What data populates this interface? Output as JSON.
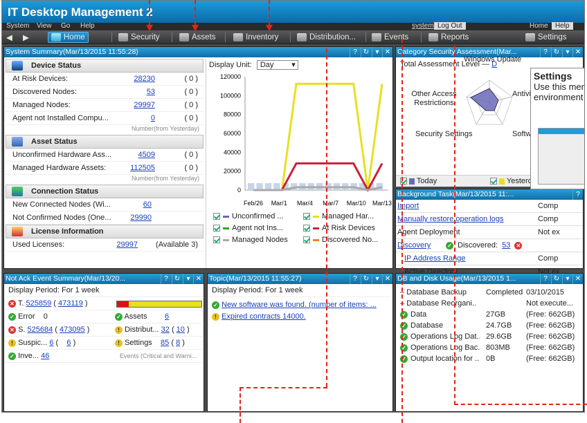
{
  "app": {
    "title": "IT Desktop Management 2"
  },
  "menu": {
    "system": "System",
    "view": "View",
    "go": "Go",
    "help": "Help",
    "user": "system",
    "logout": "Log Out",
    "home": "Home",
    "help_btn": "Help"
  },
  "toolbar": {
    "home": "Home",
    "security": "Security",
    "assets": "Assets",
    "inventory": "Inventory",
    "distribution": "Distribution...",
    "events": "Events",
    "reports": "Reports",
    "settings": "Settings"
  },
  "summary": {
    "title": "System Summary(Mar/13/2015 11:55:28)",
    "device_status": "Device Status",
    "device_rows": [
      {
        "label": "At Risk Devices:",
        "value": "28230",
        "prev": "(    0 )"
      },
      {
        "label": "Discovered Nodes:",
        "value": "53",
        "prev": "(    0 )"
      },
      {
        "label": "Managed Nodes:",
        "value": "29997",
        "prev": "(    0 )"
      },
      {
        "label": "Agent not Installed Compu...",
        "value": "0",
        "prev": "(    0 )"
      }
    ],
    "note": "Number(from Yesterday)",
    "asset_status": "Asset Status",
    "asset_rows": [
      {
        "label": "Unconfirmed Hardware Ass...",
        "value": "4509",
        "prev": "(    0 )"
      },
      {
        "label": "Managed Hardware Assets:",
        "value": "112505",
        "prev": "(    0 )"
      }
    ],
    "connection_status": "Connection Status",
    "conn_rows": [
      {
        "label": "New Connected Nodes (Wi...",
        "value": "60"
      },
      {
        "label": "Not Confirmed Nodes (One...",
        "value": "29990"
      }
    ],
    "license": "License Information",
    "license_row": {
      "label": "Used Licenses:",
      "value": "29997",
      "avail": "(Available 3)"
    },
    "display_unit_label": "Display Unit:",
    "display_unit": "Day"
  },
  "chart_data": {
    "type": "line",
    "x": [
      "Feb/26",
      "Mar/1",
      "Mar/4",
      "Mar/7",
      "Mar/10",
      "Mar/13"
    ],
    "yticks": [
      "120000",
      "100000",
      "80000",
      "60000",
      "40000",
      "20000",
      "0"
    ],
    "ylim": [
      0,
      120000
    ],
    "series": [
      {
        "name": "Unconfirmed ...",
        "color": "#6a6ab8"
      },
      {
        "name": "Managed Har...",
        "color": "#e8e020",
        "values": [
          0,
          0,
          0,
          112505,
          112505,
          112505,
          112505,
          112505,
          0,
          112505
        ]
      },
      {
        "name": "Agent not Ins...",
        "color": "#2a2"
      },
      {
        "name": "At Risk Devices",
        "color": "#c8203a",
        "values": [
          0,
          0,
          0,
          28230,
          28230,
          28230,
          28230,
          28230,
          0,
          28230
        ]
      },
      {
        "name": "Managed Nodes",
        "color": "#aaa",
        "values": [
          0,
          0,
          0,
          3000,
          3000,
          3000,
          3000,
          3000,
          0,
          3000
        ]
      },
      {
        "name": "Discovered No...",
        "color": "#f08020"
      }
    ]
  },
  "security": {
    "title": "Category Security Assessment(Mar...",
    "total_label": "Total Assessment Level",
    "total_value": "D",
    "axes": [
      "Windows Update",
      "Antivirus Software",
      "Software",
      "Security Settings",
      "Other Access Restrictions"
    ],
    "today": "Today",
    "yesterday": "Yesterday"
  },
  "tooltip": {
    "title": "Settings",
    "text": "Use this menu to set up the environment and configure settings."
  },
  "bg": {
    "title": "Background Task(Mar/13/2015 11:...",
    "rows": [
      {
        "name": "Import",
        "status": "Comp"
      },
      {
        "name": "Manually restore operation logs",
        "status": "Comp"
      },
      {
        "name": "Agent Deployment",
        "status": "Not ex"
      },
      {
        "name": "Discovery",
        "discovered": "Discovered:",
        "count": "53"
      },
      {
        "name": "IP Address Range",
        "status": "Comp"
      },
      {
        "name": "Active Directory",
        "status": "Not ex"
      }
    ]
  },
  "events": {
    "title": "Not Ack Event Summary(Mar/13/20...",
    "period": "Display Period:  For 1 week",
    "total_label": "T.",
    "total": "525859",
    "total_paren": "473119",
    "error_label": "Error",
    "error_value": "0",
    "assets_label": "Assets",
    "assets_value": "6",
    "sec_label": "S.",
    "sec": "525684",
    "sec_paren": "473095",
    "dist_label": "Distribut...",
    "dist_value": "32",
    "dist_paren": "10",
    "susp_label": "Suspic...",
    "susp_value": "6",
    "susp_paren": "6",
    "settings_label": "Settings",
    "settings_value": "85",
    "settings_paren": "8",
    "inv_label": "Inve...",
    "inv_value": "46",
    "footer": "Events (Critical and Warni..."
  },
  "topic": {
    "title": "Topic(Mar/13/2015 11:55:27)",
    "period": "Display Period:  For 1 week",
    "items": [
      "New software was found. (number of items: ...",
      "Expired contracts 14000."
    ]
  },
  "db": {
    "title": "DB and Disk Usage(Mar/13/2015 1...",
    "rows": [
      {
        "name": "Database Backup",
        "size": "Completed",
        "free": "03/10/2015"
      },
      {
        "name": "Database Reorgani...",
        "size": "",
        "free": "Not execute..."
      },
      {
        "name": "Data",
        "size": "27GB",
        "free": "(Free: 662GB)"
      },
      {
        "name": "Database",
        "size": "24.7GB",
        "free": "(Free: 662GB)"
      },
      {
        "name": "Operations Log Dat...",
        "size": "29.6GB",
        "free": "(Free: 662GB)"
      },
      {
        "name": "Operations Log Bac...",
        "size": "803MB",
        "free": "(Free: 662GB)"
      },
      {
        "name": "Output location for ...",
        "size": "0B",
        "free": "(Free: 662GB)"
      }
    ]
  }
}
